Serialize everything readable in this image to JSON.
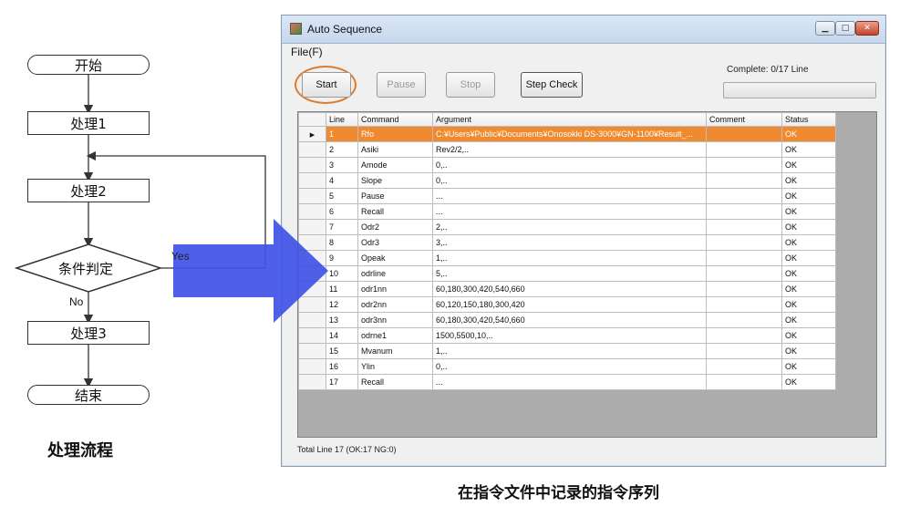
{
  "flowchart": {
    "start": "开始",
    "process1": "处理1",
    "process2": "处理2",
    "condition": "条件判定",
    "yes_label": "Yes",
    "no_label": "No",
    "process3": "处理3",
    "end": "结束",
    "caption": "处理流程"
  },
  "window": {
    "title": "Auto Sequence",
    "menu_file": "File(F)",
    "buttons": {
      "start": "Start",
      "pause": "Pause",
      "stop": "Stop",
      "step_check": "Step Check"
    },
    "complete_label": "Complete: 0/17 Line",
    "progress_fraction": 0,
    "columns": [
      "",
      "Line",
      "Command",
      "Argument",
      "Comment",
      "Status"
    ],
    "rows": [
      {
        "line": "1",
        "command": "Rfo",
        "argument": "C:¥Users¥Public¥Documents¥Onosokki DS-3000¥GN-1100¥Result_...",
        "comment": "",
        "status": "OK"
      },
      {
        "line": "2",
        "command": "Asiki",
        "argument": "Rev2/2,..",
        "comment": "",
        "status": "OK"
      },
      {
        "line": "3",
        "command": "Amode",
        "argument": "0,..",
        "comment": "",
        "status": "OK"
      },
      {
        "line": "4",
        "command": "Slope",
        "argument": "0,..",
        "comment": "",
        "status": "OK"
      },
      {
        "line": "5",
        "command": "Pause",
        "argument": "...",
        "comment": "",
        "status": "OK"
      },
      {
        "line": "6",
        "command": "Recall",
        "argument": "...",
        "comment": "",
        "status": "OK"
      },
      {
        "line": "7",
        "command": "Odr2",
        "argument": "2,..",
        "comment": "",
        "status": "OK"
      },
      {
        "line": "8",
        "command": "Odr3",
        "argument": "3,..",
        "comment": "",
        "status": "OK"
      },
      {
        "line": "9",
        "command": "Opeak",
        "argument": "1,..",
        "comment": "",
        "status": "OK"
      },
      {
        "line": "10",
        "command": "odrline",
        "argument": "5,..",
        "comment": "",
        "status": "OK"
      },
      {
        "line": "11",
        "command": "odr1nn",
        "argument": "60,180,300,420,540,660",
        "comment": "",
        "status": "OK"
      },
      {
        "line": "12",
        "command": "odr2nn",
        "argument": "60,120,150,180,300,420",
        "comment": "",
        "status": "OK"
      },
      {
        "line": "13",
        "command": "odr3nn",
        "argument": "60,180,300,420,540,660",
        "comment": "",
        "status": "OK"
      },
      {
        "line": "14",
        "command": "odrne1",
        "argument": "1500,5500,10,..",
        "comment": "",
        "status": "OK"
      },
      {
        "line": "15",
        "command": "Mvanum",
        "argument": "1,..",
        "comment": "",
        "status": "OK"
      },
      {
        "line": "16",
        "command": "Ylin",
        "argument": "0,..",
        "comment": "",
        "status": "OK"
      },
      {
        "line": "17",
        "command": "Recall",
        "argument": "...",
        "comment": "",
        "status": "OK"
      }
    ],
    "status_bar": "Total Line 17 (OK:17 NG:0)",
    "caption": "在指令文件中记录的指令序列"
  },
  "colors": {
    "highlight_row": "#f08a30",
    "arrow": "#3f52e6",
    "start_circle": "#e07b2a"
  }
}
